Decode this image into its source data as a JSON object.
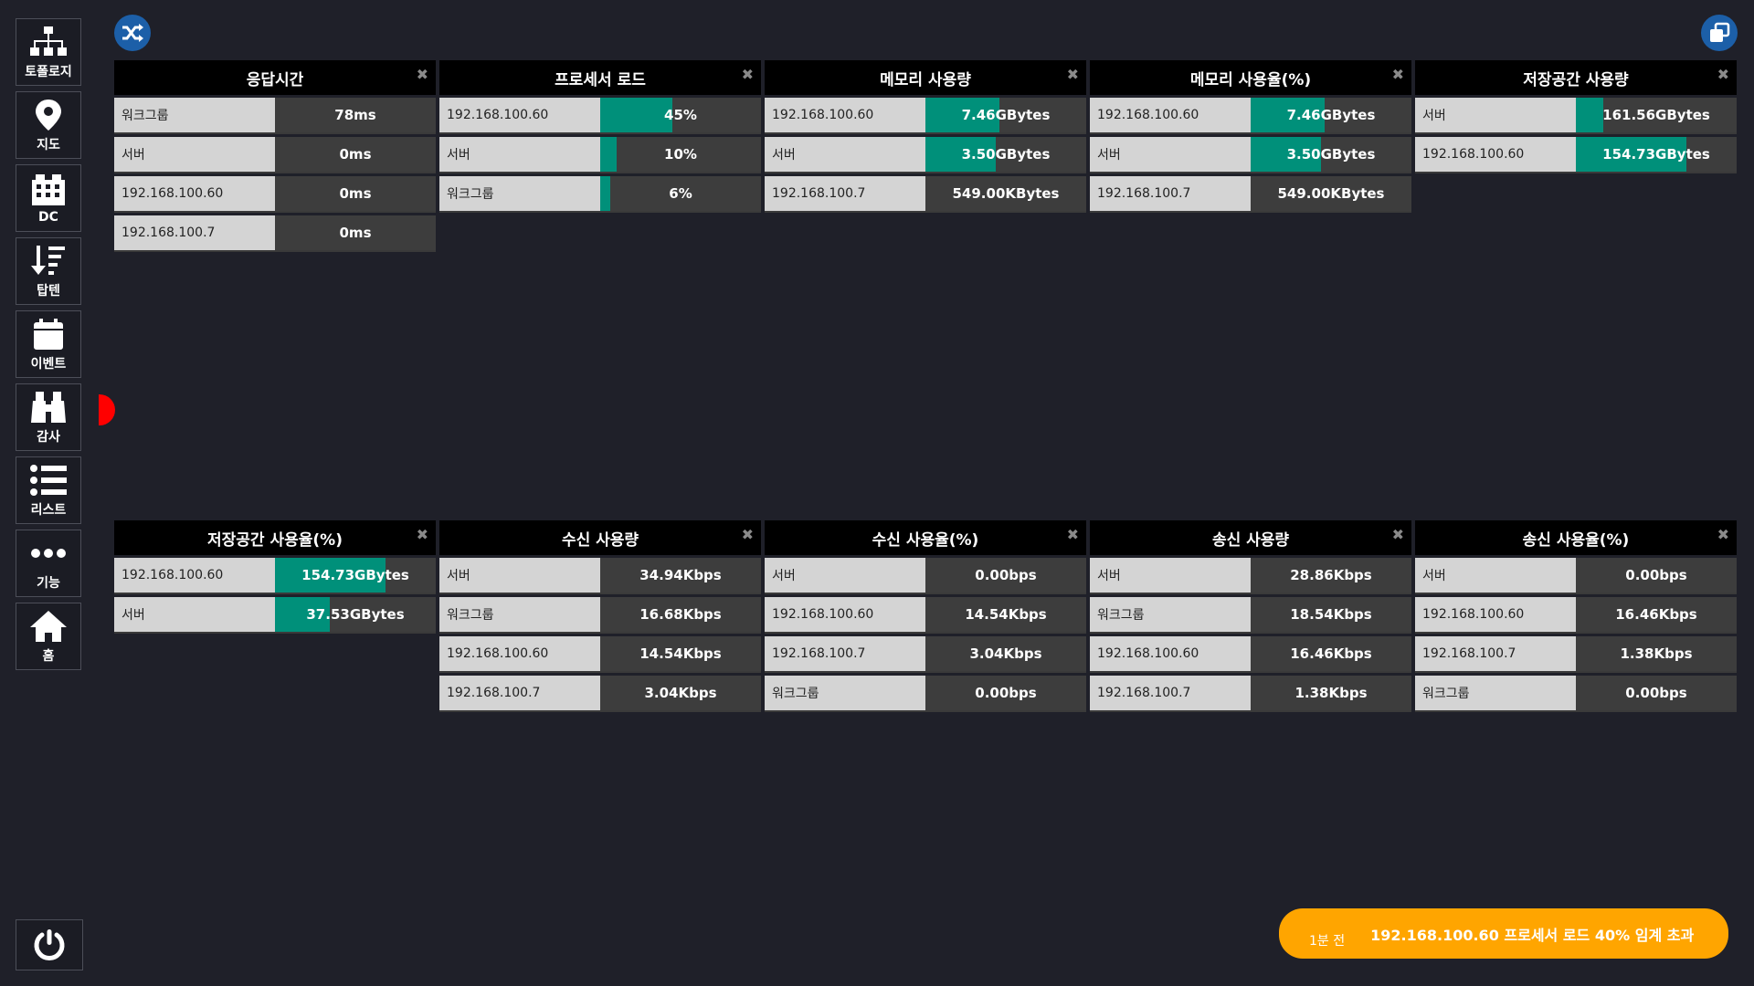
{
  "sidebar": {
    "items": [
      {
        "label": "토폴로지",
        "icon": "topology-icon"
      },
      {
        "label": "지도",
        "icon": "map-pin-icon"
      },
      {
        "label": "DC",
        "icon": "building-icon"
      },
      {
        "label": "탑텐",
        "icon": "sort-down-icon"
      },
      {
        "label": "이벤트",
        "icon": "calendar-icon"
      },
      {
        "label": "감사",
        "icon": "binoculars-icon"
      },
      {
        "label": "리스트",
        "icon": "list-icon"
      },
      {
        "label": "기능",
        "icon": "more-icon"
      },
      {
        "label": "홈",
        "icon": "home-icon"
      }
    ]
  },
  "colors": {
    "bar": "#00907a",
    "toast": "#ffa500",
    "button": "#1c5fa8"
  },
  "panels": [
    {
      "title": "응답시간",
      "rows": [
        {
          "label": "워크그룹",
          "value": "78ms",
          "fill": 0
        },
        {
          "label": "서버",
          "value": "0ms",
          "fill": 0
        },
        {
          "label": "192.168.100.60",
          "value": "0ms",
          "fill": 0
        },
        {
          "label": "192.168.100.7",
          "value": "0ms",
          "fill": 0
        }
      ]
    },
    {
      "title": "프로세서 로드",
      "rows": [
        {
          "label": "192.168.100.60",
          "value": "45%",
          "fill": 0.45
        },
        {
          "label": "서버",
          "value": "10%",
          "fill": 0.1
        },
        {
          "label": "워크그룹",
          "value": "6%",
          "fill": 0.06
        }
      ]
    },
    {
      "title": "메모리 사용량",
      "rows": [
        {
          "label": "192.168.100.60",
          "value": "7.46GBytes",
          "fill": 0.46
        },
        {
          "label": "서버",
          "value": "3.50GBytes",
          "fill": 0.44
        },
        {
          "label": "192.168.100.7",
          "value": "549.00KBytes",
          "fill": 0
        }
      ]
    },
    {
      "title": "메모리 사용율(%)",
      "rows": [
        {
          "label": "192.168.100.60",
          "value": "7.46GBytes",
          "fill": 0.46
        },
        {
          "label": "서버",
          "value": "3.50GBytes",
          "fill": 0.44
        },
        {
          "label": "192.168.100.7",
          "value": "549.00KBytes",
          "fill": 0
        }
      ]
    },
    {
      "title": "저장공간 사용량",
      "rows": [
        {
          "label": "서버",
          "value": "161.56GBytes",
          "fill": 0.17
        },
        {
          "label": "192.168.100.60",
          "value": "154.73GBytes",
          "fill": 0.69
        }
      ]
    },
    {
      "title": "저장공간 사용율(%)",
      "rows": [
        {
          "label": "192.168.100.60",
          "value": "154.73GBytes",
          "fill": 0.69
        },
        {
          "label": "서버",
          "value": "37.53GBytes",
          "fill": 0.34
        }
      ]
    },
    {
      "title": "수신 사용량",
      "rows": [
        {
          "label": "서버",
          "value": "34.94Kbps",
          "fill": 0
        },
        {
          "label": "워크그룹",
          "value": "16.68Kbps",
          "fill": 0
        },
        {
          "label": "192.168.100.60",
          "value": "14.54Kbps",
          "fill": 0
        },
        {
          "label": "192.168.100.7",
          "value": "3.04Kbps",
          "fill": 0
        }
      ]
    },
    {
      "title": "수신 사용율(%)",
      "rows": [
        {
          "label": "서버",
          "value": "0.00bps",
          "fill": 0
        },
        {
          "label": "192.168.100.60",
          "value": "14.54Kbps",
          "fill": 0
        },
        {
          "label": "192.168.100.7",
          "value": "3.04Kbps",
          "fill": 0
        },
        {
          "label": "워크그룹",
          "value": "0.00bps",
          "fill": 0
        }
      ]
    },
    {
      "title": "송신 사용량",
      "rows": [
        {
          "label": "서버",
          "value": "28.86Kbps",
          "fill": 0
        },
        {
          "label": "워크그룹",
          "value": "18.54Kbps",
          "fill": 0
        },
        {
          "label": "192.168.100.60",
          "value": "16.46Kbps",
          "fill": 0
        },
        {
          "label": "192.168.100.7",
          "value": "1.38Kbps",
          "fill": 0
        }
      ]
    },
    {
      "title": "송신 사용율(%)",
      "rows": [
        {
          "label": "서버",
          "value": "0.00bps",
          "fill": 0
        },
        {
          "label": "192.168.100.60",
          "value": "16.46Kbps",
          "fill": 0
        },
        {
          "label": "192.168.100.7",
          "value": "1.38Kbps",
          "fill": 0
        },
        {
          "label": "워크그룹",
          "value": "0.00bps",
          "fill": 0
        }
      ]
    }
  ],
  "close_symbol": "✖",
  "toast": {
    "time": "1분 전",
    "message": "192.168.100.60 프로세서 로드 40% 임계 초과"
  }
}
